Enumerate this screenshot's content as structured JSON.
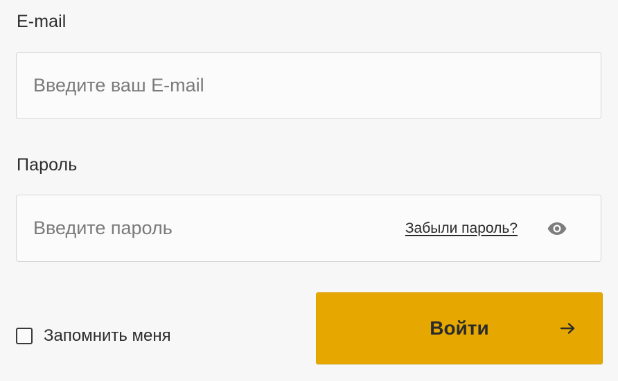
{
  "email": {
    "label": "E-mail",
    "placeholder": "Введите ваш E-mail",
    "value": ""
  },
  "password": {
    "label": "Пароль",
    "placeholder": "Введите пароль",
    "value": "",
    "forgot_label": "Забыли пароль?",
    "toggle_icon": "eye-icon"
  },
  "remember": {
    "label": "Запомнить меня",
    "checked": false
  },
  "submit": {
    "label": "Войти",
    "icon": "arrow-right-icon"
  },
  "colors": {
    "accent": "#e6a800",
    "background": "#f7f7f7",
    "border": "#d7d7d7"
  }
}
